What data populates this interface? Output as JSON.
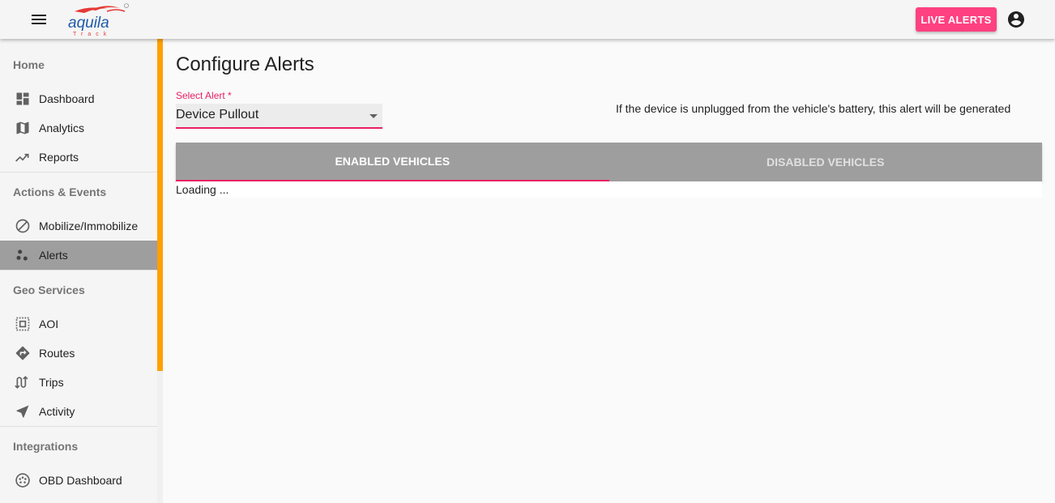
{
  "header": {
    "logo_text": "aquila",
    "logo_subtext": "Track",
    "live_alerts_label": "LIVE ALERTS",
    "menu_icon": "menu-icon",
    "account_icon": "account-circle-icon"
  },
  "sidebar": {
    "sections": [
      {
        "title": "Home",
        "items": [
          {
            "label": "Dashboard",
            "icon": "dashboard-icon"
          },
          {
            "label": "Analytics",
            "icon": "map-icon"
          },
          {
            "label": "Reports",
            "icon": "trending-icon"
          }
        ]
      },
      {
        "title": "Actions & Events",
        "items": [
          {
            "label": "Mobilize/Immobilize",
            "icon": "block-icon"
          },
          {
            "label": "Alerts",
            "icon": "scatter-icon",
            "active": true
          }
        ]
      },
      {
        "title": "Geo Services",
        "items": [
          {
            "label": "AOI",
            "icon": "select-area-icon"
          },
          {
            "label": "Routes",
            "icon": "directions-icon"
          },
          {
            "label": "Trips",
            "icon": "trip-icon"
          },
          {
            "label": "Activity",
            "icon": "navigation-icon"
          }
        ]
      },
      {
        "title": "Integrations",
        "items": [
          {
            "label": "OBD Dashboard",
            "icon": "obd-icon"
          }
        ]
      }
    ]
  },
  "main": {
    "title": "Configure Alerts",
    "select": {
      "label": "Select Alert *",
      "value": "Device Pullout"
    },
    "description": "If the device is unplugged from the vehicle's battery, this alert will be generated",
    "tabs": [
      {
        "label": "ENABLED VEHICLES",
        "active": true
      },
      {
        "label": "DISABLED VEHICLES",
        "active": false
      }
    ],
    "loading_text": "Loading ..."
  },
  "colors": {
    "accent": "#e91e63",
    "live_alerts": "#ff4081",
    "scroll_thumb": "#ffa000",
    "tab_bar": "#9e9e9e"
  }
}
